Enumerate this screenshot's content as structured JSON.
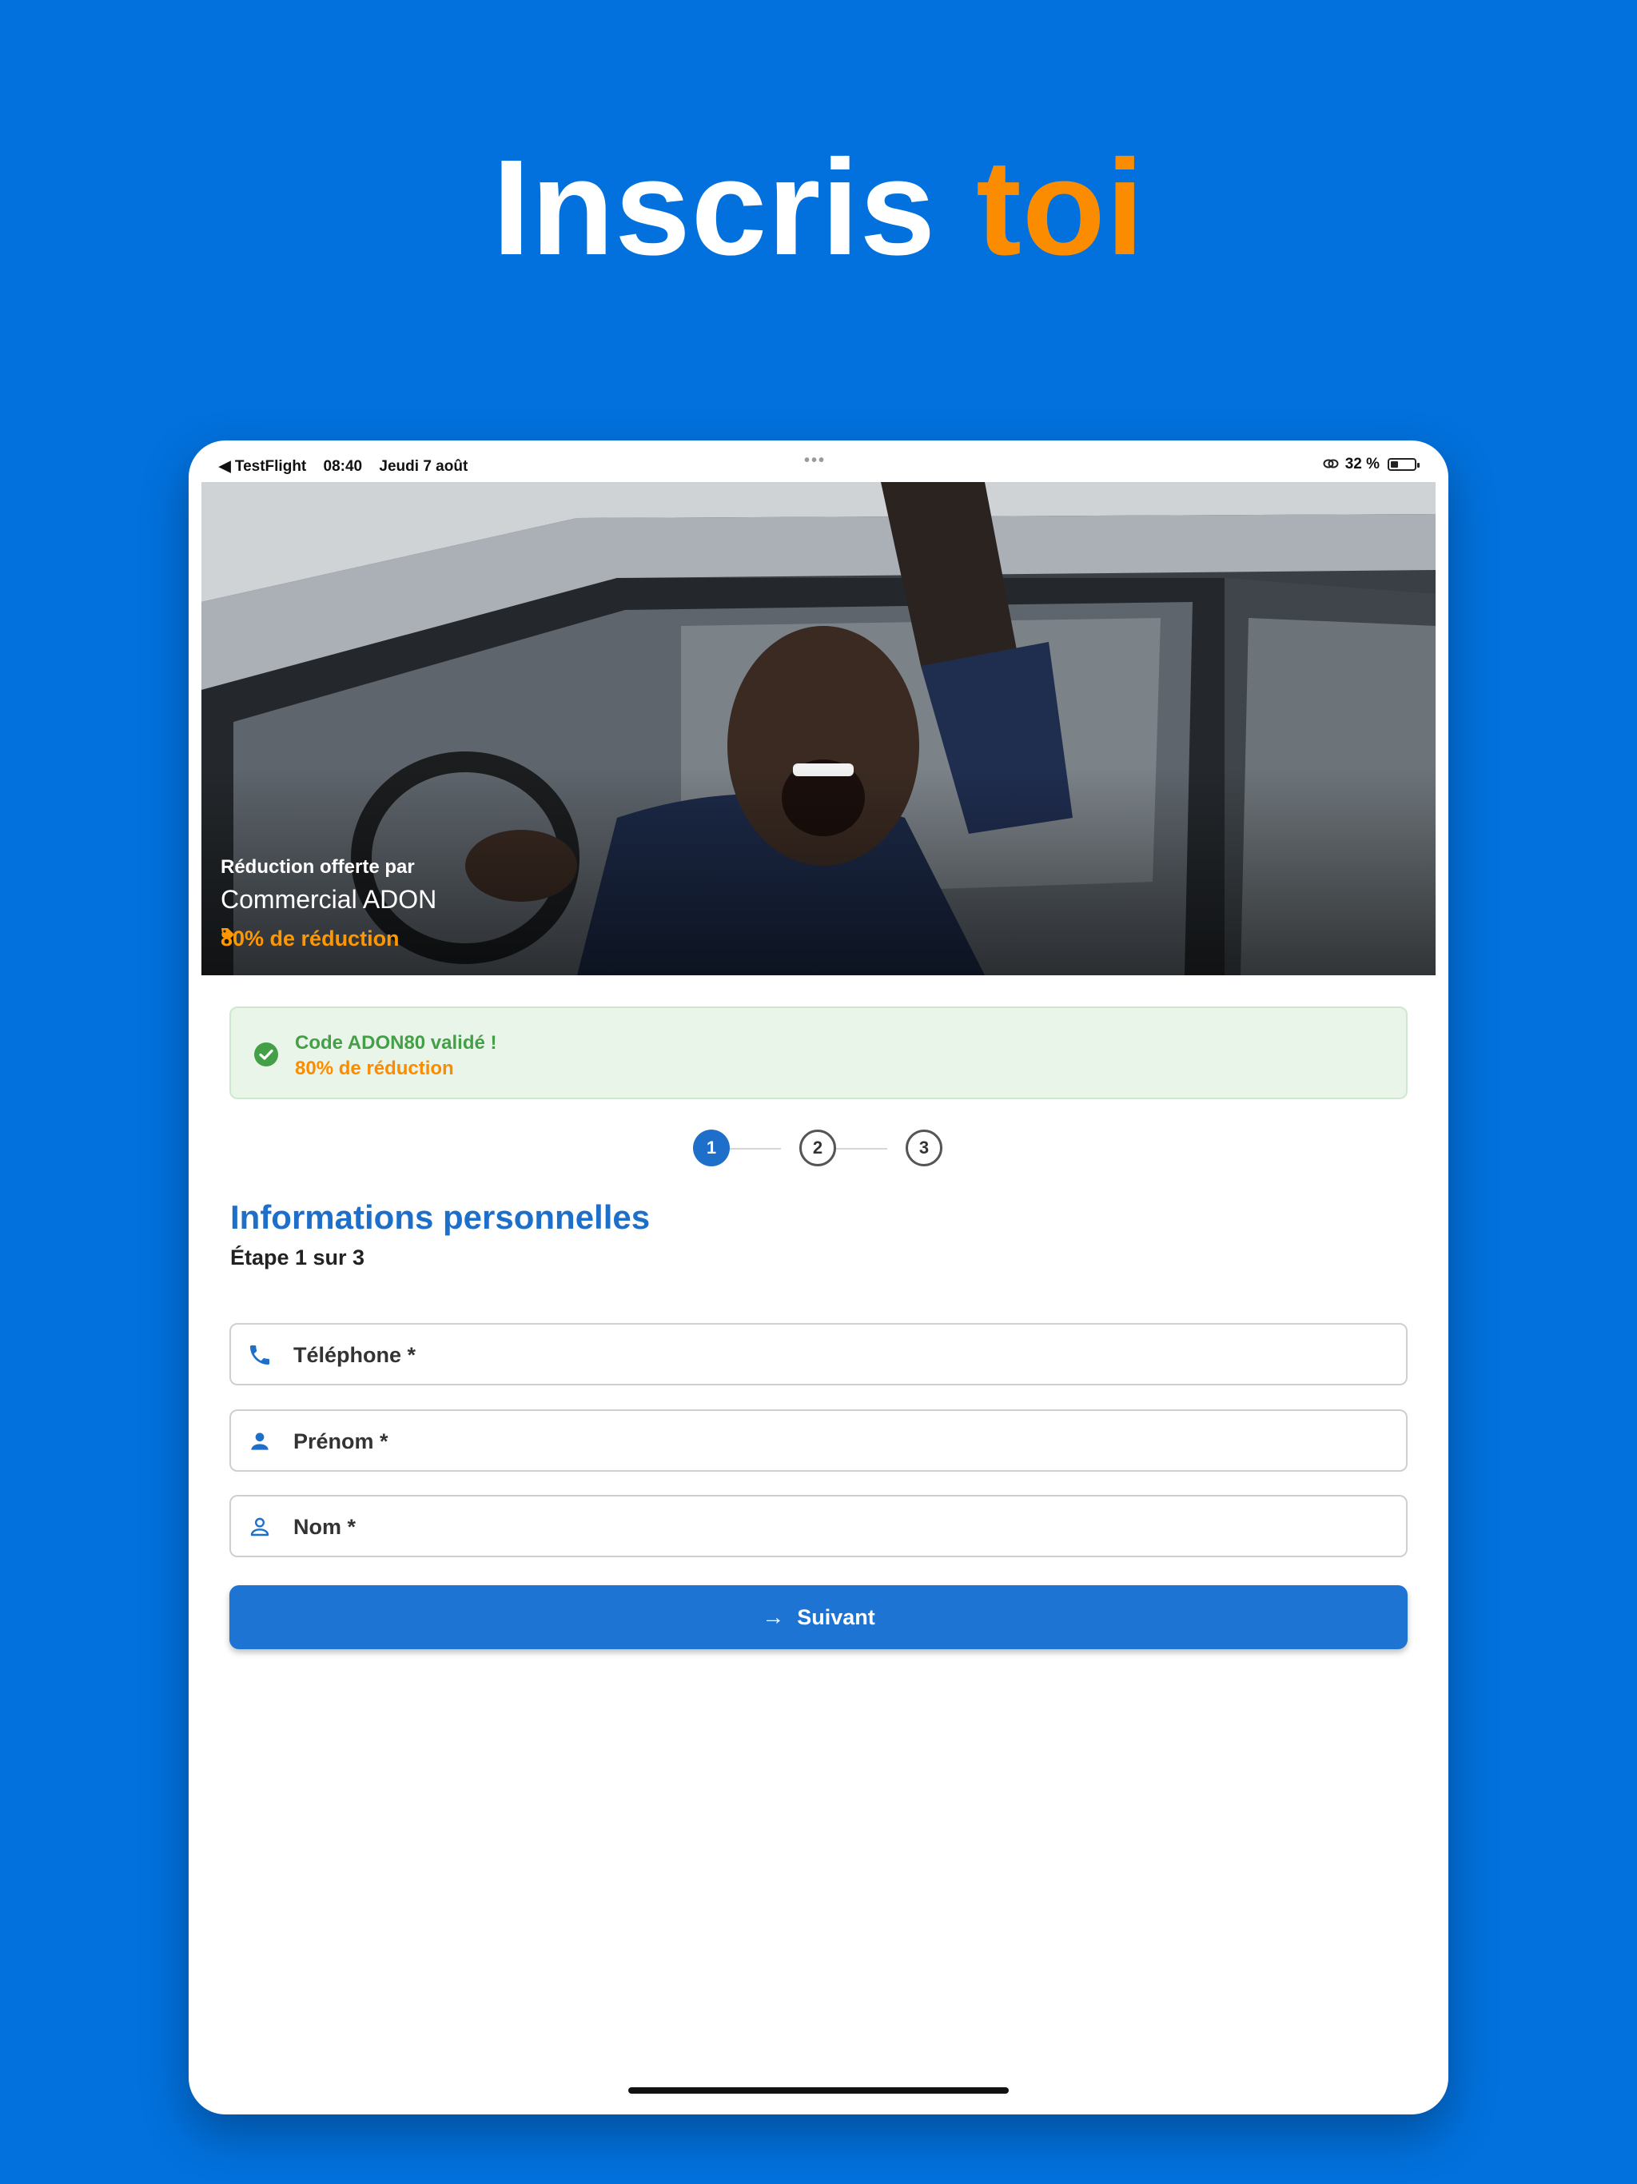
{
  "headline": {
    "text": "Inscris",
    "accent": "toi"
  },
  "status_bar": {
    "back_app": "◀ TestFlight",
    "time": "08:40",
    "date": "Jeudi 7 août",
    "dots": "•••",
    "battery_text": "32 %",
    "battery_level": 0.32
  },
  "hero": {
    "subtitle": "Réduction offerte par",
    "title": "Commercial ADON",
    "discount": "80% de réduction",
    "discount_icon": "tag-icon"
  },
  "promo": {
    "line1": "Code ADON80 validé !",
    "line2": "80% de réduction",
    "icon": "check-circle-icon"
  },
  "stepper": {
    "steps": [
      "1",
      "2",
      "3"
    ],
    "current": 1
  },
  "form": {
    "title": "Informations personnelles",
    "subtitle": "Étape 1 sur 3",
    "fields": [
      {
        "label": "Téléphone *",
        "icon": "phone-icon"
      },
      {
        "label": "Prénom *",
        "icon": "person-filled-icon"
      },
      {
        "label": "Nom *",
        "icon": "person-outline-icon"
      }
    ],
    "next_button": {
      "arrow": "→",
      "label": "Suivant"
    }
  },
  "colors": {
    "background": "#0271DD",
    "accent_orange": "#FB8C00",
    "primary_blue": "#1E6FC9",
    "success_green": "#43A047"
  }
}
